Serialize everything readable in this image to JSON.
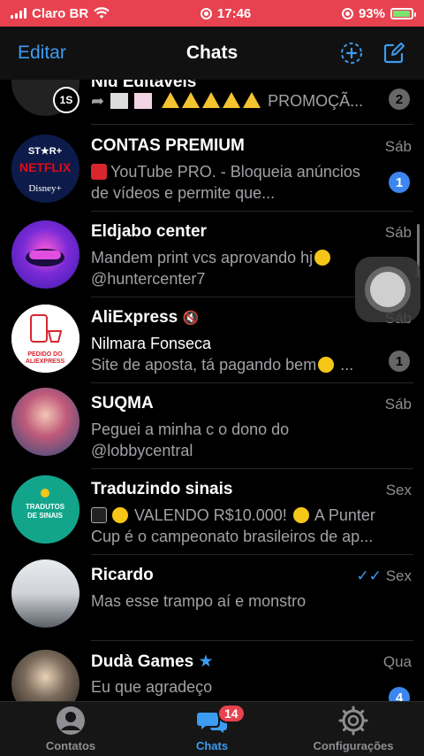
{
  "status_bar": {
    "carrier": "Claro BR",
    "time": "17:46",
    "battery": "93%",
    "battery_level": 0.93,
    "bar_color": "#e8414f"
  },
  "nav": {
    "edit_label": "Editar",
    "title": "Chats",
    "new_group_icon": "add-circle-icon",
    "compose_icon": "compose-icon"
  },
  "partial_row": {
    "name": "Nid Editaveis",
    "timer": "1S",
    "preview": "PROMOÇÃ...",
    "badge": "2"
  },
  "chats": [
    {
      "name": "CONTAS PREMIUM",
      "time": "Sáb",
      "preview": "YouTube PRO. - Bloqueia anúncios de vídeos e permite que...",
      "badge": "1",
      "badge_style": "blue",
      "avatar_color": "#0d1b4a"
    },
    {
      "name": "Eldjabo center",
      "time": "Sáb",
      "preview": "Mandem print vcs aprovando hj",
      "preview2": "@huntercenter7",
      "badge": "",
      "avatar_color": "#5a2bd6"
    },
    {
      "name": "AliExpress",
      "time": "Sáb",
      "muted": true,
      "sender": "Nilmara Fonseca",
      "preview": "Site de aposta, tá pagando bem",
      "badge": "1",
      "badge_style": "gray",
      "avatar_text": "PEDIDO DO ALIEXPRESS",
      "avatar_color": "#ffffff"
    },
    {
      "name": "SUQMA",
      "time": "Sáb",
      "preview": "Peguei a minha c o dono do @lobbycentral",
      "badge": "",
      "avatar_color": "#b84a6a"
    },
    {
      "name": "Traduzindo sinais",
      "time": "Sex",
      "preview": "VALENDO R$10.000!",
      "preview_tail": "A Punter Cup é o campeonato brasileiros de ap...",
      "badge": "",
      "avatar_text": "TRADUTOS DE SINAIS",
      "avatar_color": "#12a58c"
    },
    {
      "name": "Ricardo",
      "time": "Sex",
      "read": true,
      "preview": "Mas esse trampo aí e monstro",
      "badge": "",
      "avatar_color": "#cfd3d8"
    },
    {
      "name": "Dudà Games",
      "time": "Qua",
      "starred": true,
      "preview": "Eu que agradeço",
      "badge": "4",
      "badge_style": "blue",
      "avatar_color": "#2a2a2a"
    }
  ],
  "tabbar": {
    "tabs": [
      {
        "label": "Contatos",
        "icon": "person-icon"
      },
      {
        "label": "Chats",
        "icon": "chats-icon",
        "badge": "14",
        "active": true
      },
      {
        "label": "Configurações",
        "icon": "gear-icon"
      }
    ],
    "accent": "#3b9cf2"
  }
}
